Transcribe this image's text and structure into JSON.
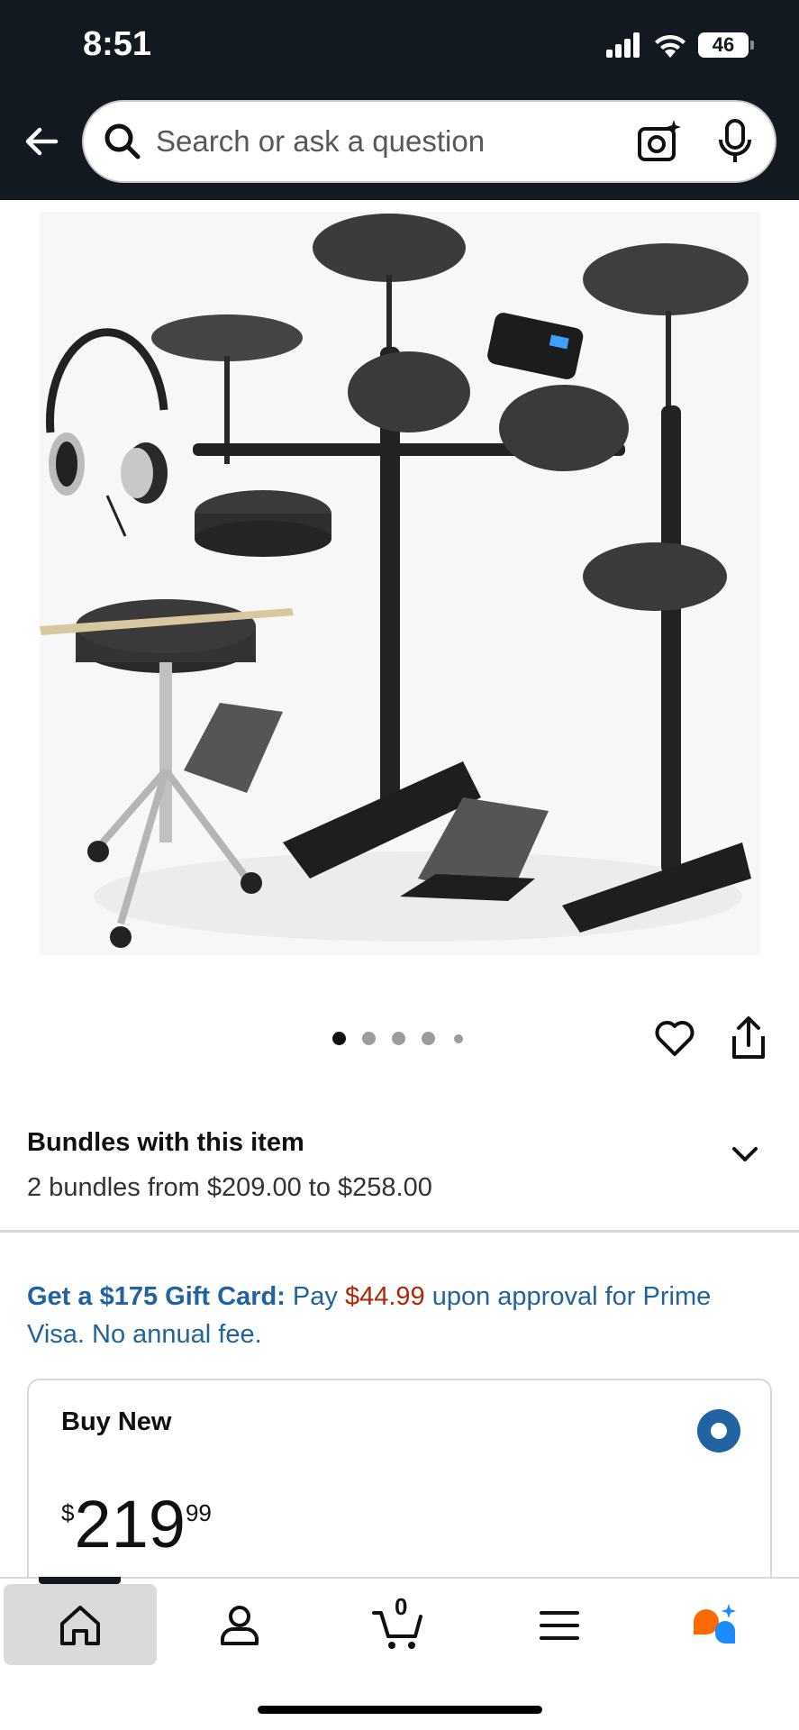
{
  "status_bar": {
    "time": "8:51",
    "battery": "46"
  },
  "search": {
    "placeholder": "Search or ask a question"
  },
  "image_pager": {
    "total": 5,
    "current": 1
  },
  "bundles": {
    "title": "Bundles with this item",
    "subtitle": "2 bundles from $209.00 to $258.00"
  },
  "promo": {
    "bold": "Get a $175 Gift Card:",
    "text1": " Pay ",
    "price": "$44.99",
    "text2": " upon approval for Prime Visa. No annual fee."
  },
  "buy_new": {
    "title": "Buy New",
    "currency": "$",
    "price_whole": "219",
    "price_fraction": "99"
  },
  "tab_bar": {
    "cart_count": "0",
    "items": [
      "home-icon",
      "account-icon",
      "cart-icon",
      "menu-icon",
      "rufus-icon"
    ]
  },
  "colors": {
    "header_bg": "#131921",
    "link_blue": "#2162a1",
    "price_red": "#b12704",
    "rufus_orange": "#ff6a00",
    "rufus_blue": "#1a8cff"
  }
}
